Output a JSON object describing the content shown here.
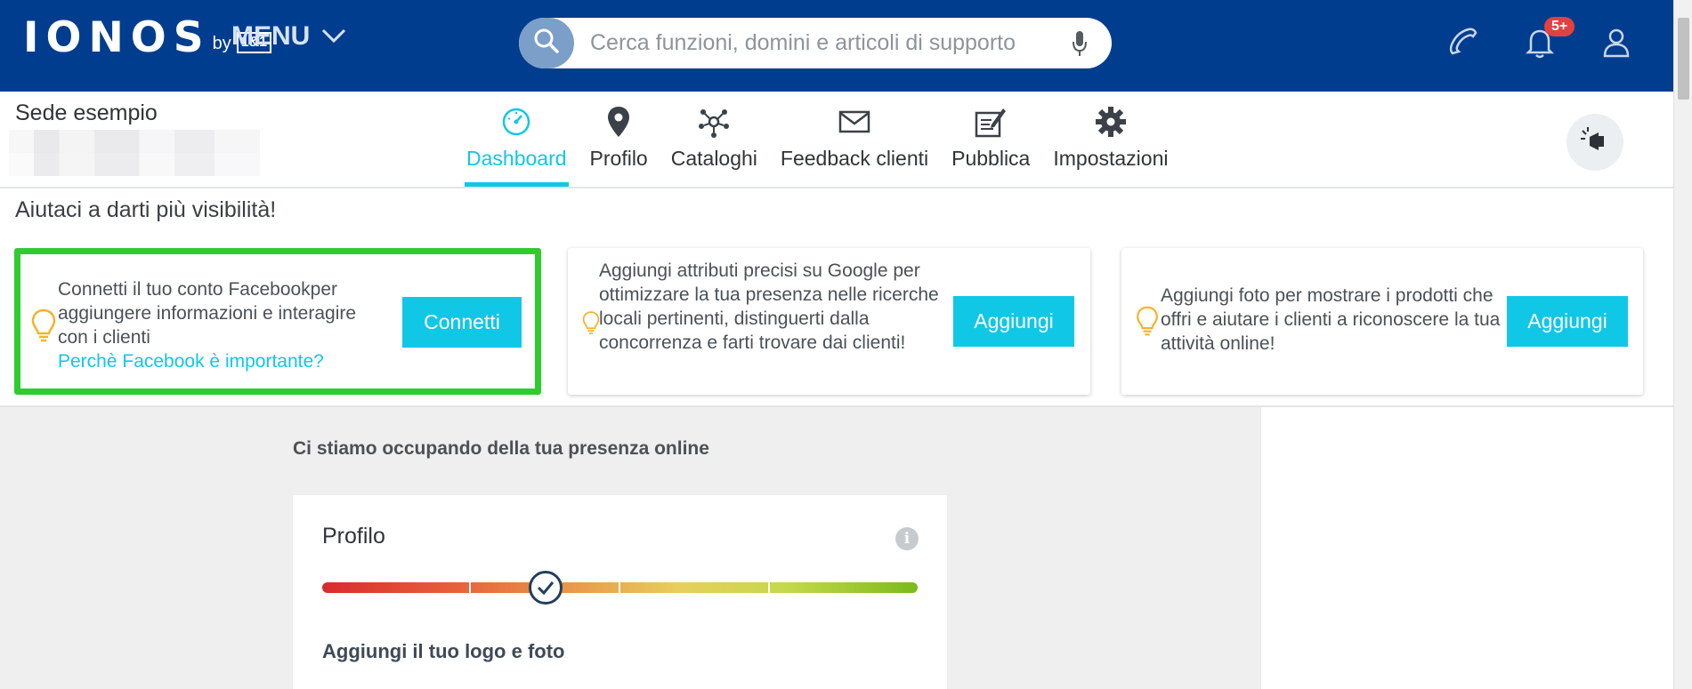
{
  "topbar": {
    "logo_text": "IONOS",
    "logo_by": "by",
    "logo_partner": "1&1",
    "menu_label": "MENU",
    "search_placeholder": "Cerca funzioni, domini e articoli di supporto",
    "notification_badge": "5+",
    "icons": [
      "search-icon",
      "microphone-icon",
      "phone-icon",
      "bell-icon",
      "user-icon"
    ]
  },
  "location": {
    "name": "Sede esempio"
  },
  "tabs": [
    {
      "label": "Dashboard",
      "icon": "gauge-icon",
      "active": true
    },
    {
      "label": "Profilo",
      "icon": "map-pin-icon"
    },
    {
      "label": "Cataloghi",
      "icon": "network-icon"
    },
    {
      "label": "Feedback clienti",
      "icon": "envelope-icon"
    },
    {
      "label": "Pubblica",
      "icon": "edit-post-icon"
    },
    {
      "label": "Impostazioni",
      "icon": "gear-icon"
    }
  ],
  "visibility": {
    "title": "Aiutaci a darti più visibilità!",
    "cards": [
      {
        "text": "Connetti il tuo conto Facebookper aggiungere informazioni e interagire con i clienti",
        "link": "Perchè Facebook è importante?",
        "button": "Connetti"
      },
      {
        "text": "Aggiungi attributi precisi su Google per ottimizzare la tua presenza nelle ricerche locali pertinenti, distinguerti dalla concorrenza e farti trovare dai clienti!",
        "button": "Aggiungi"
      },
      {
        "text": "Aggiungi foto per mostrare i prodotti che offri e aiutare i clienti a riconoscere la tua attività online!",
        "button": "Aggiungi"
      }
    ]
  },
  "presence": {
    "title": "Ci stiamo occupando della tua presenza online",
    "profile": {
      "title": "Profilo",
      "progress_position": 0.375,
      "next_step": "Aggiungi il tuo logo e foto"
    }
  },
  "colors": {
    "brand_blue": "#003d8f",
    "accent_cyan": "#11c7e6",
    "highlight_green": "#2ecc2e",
    "badge_red": "#e34040"
  }
}
